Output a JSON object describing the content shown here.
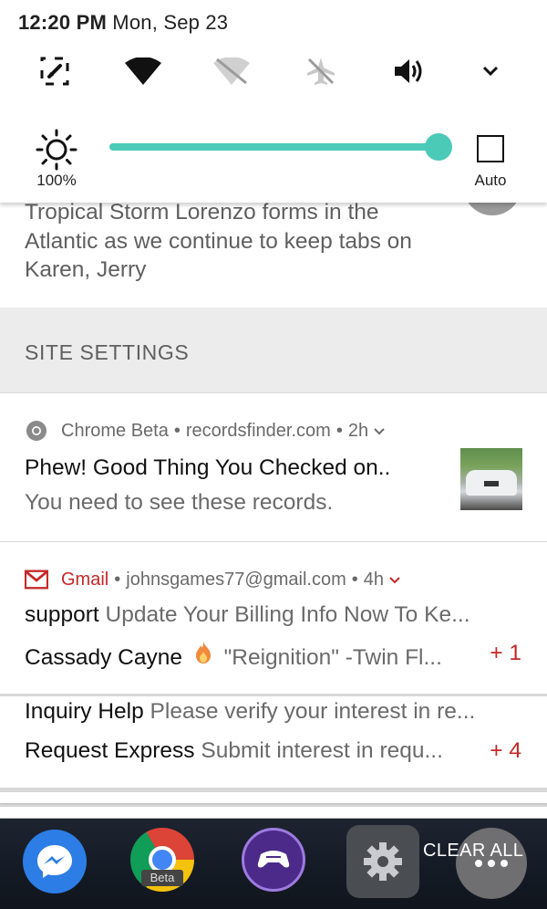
{
  "status_bar": {
    "time": "12:20 PM",
    "date": "Mon, Sep 23"
  },
  "quick_settings": {
    "icons": [
      "screen-cast-icon",
      "wifi-icon",
      "cellular-off-icon",
      "airplane-mode-off-icon",
      "volume-icon",
      "expand-chevron-icon"
    ],
    "brightness_label": "100%",
    "brightness_level": 1.0,
    "auto_label": "Auto",
    "accent_color": "#4ccab8"
  },
  "news_notification": {
    "text": "Tropical Storm Lorenzo forms in the Atlantic as we continue to keep tabs on Karen, Jerry"
  },
  "site_settings": {
    "label": "SITE SETTINGS"
  },
  "chrome_notification": {
    "app": "Chrome Beta",
    "site": "recordsfinder.com",
    "age": "2h",
    "title": "Phew! Good Thing You Checked on..",
    "body": "You need to see these records."
  },
  "gmail_notification": {
    "app": "Gmail",
    "account": "johnsgames77@gmail.com",
    "age": "4h",
    "brand_color": "#c62828",
    "emails": [
      {
        "sender": "support",
        "subject": "Update Your Billing Info Now To Ke...",
        "count": ""
      },
      {
        "sender": "Cassady Cayne",
        "subject": "\"Reignition\" -Twin Fl...",
        "count": "+ 1"
      }
    ]
  },
  "gmail_notification_2": {
    "emails": [
      {
        "sender": "Inquiry Help",
        "subject": "Please verify your interest in re...",
        "count": ""
      },
      {
        "sender": "Request Express",
        "subject": "Submit interest in requ...",
        "count": "+ 4"
      }
    ]
  },
  "dock": {
    "apps": [
      "messenger-icon",
      "chrome-beta-icon",
      "game-app-icon",
      "settings-icon",
      "more-icon"
    ],
    "chrome_badge": "Beta",
    "clear_all": "CLEAR ALL"
  }
}
